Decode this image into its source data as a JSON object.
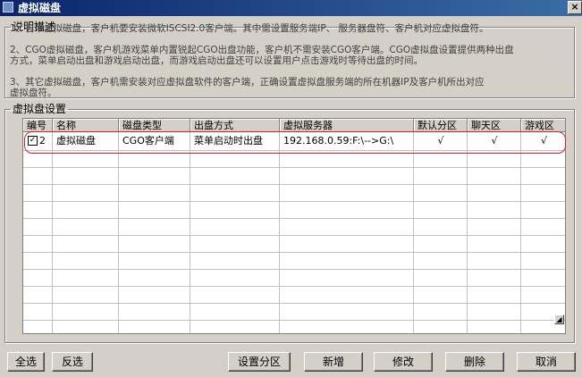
{
  "window": {
    "title": "虚拟磁盘",
    "close_glyph": "×"
  },
  "description": {
    "legend": "说明描述",
    "lines": [
      "1、自带虚拟磁盘，客户机要安装微软ISCSI2.0客户端。其中需设置服务端IP、 服务器盘符、客户机对应虚拟盘符。",
      "2、CGO虚拟磁盘，客户机游戏菜单内置锐起CGO出盘功能，客户机不需安装CGO客户端。CGO虚拟盘设置提供两种出盘\n    方式，菜单启动出盘和游戏启动出盘，而游戏启动出盘还可以设置用户点击游戏时等待出盘的时间。",
      "3、其它虚拟磁盘，客户机需安装对应虚拟盘软件的客户端，正确设置虚拟盘服务端的所在机器IP及客户机所出对应\n    虚拟盘符。"
    ]
  },
  "vdisk": {
    "legend": "虚拟盘设置",
    "columns": [
      "编号",
      "名称",
      "磁盘类型",
      "出盘方式",
      "虚拟服务器",
      "默认分区",
      "聊天区",
      "游戏区"
    ],
    "rows": [
      {
        "checked": true,
        "check_glyph": "✓",
        "id": "2",
        "name": "虚拟磁盘",
        "disk_type": "CGO客户端",
        "mount_mode": "菜单启动时出盘",
        "server": "192.168.0.59:F:\\-->G:\\",
        "default_partition": "√",
        "chat_zone": "√",
        "game_zone": "√"
      }
    ]
  },
  "scrollbar": {
    "thumb_glyph": "◢"
  },
  "buttons": {
    "select_all": "全选",
    "invert": "反选",
    "set_partition": "设置分区",
    "add": "新增",
    "edit": "修改",
    "delete": "删除",
    "cancel": "取消"
  }
}
